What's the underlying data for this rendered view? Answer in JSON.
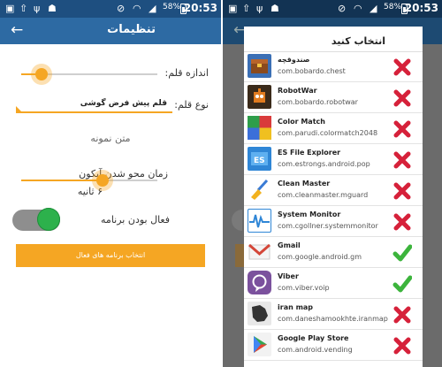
{
  "status_bar": {
    "time": "20:53",
    "battery": "58%"
  },
  "settings": {
    "title": "تنظیمات",
    "pen_size_label": "اندازه قلم:",
    "pen_size_level": 0.15,
    "pen_type_label": "نوع قلم:",
    "pen_type_value": "قلم پیش فرض گوشی",
    "sample_text": "متن نمونه",
    "fade_label": "زمان محو شدن آیکون",
    "fade_value": "۶ ثانیه",
    "fade_level": 0.6,
    "enable_label": "فعال بودن برنامه",
    "enabled": true,
    "select_apps_button": "انتخاب برنامه های فعال"
  },
  "dialog": {
    "title": "انتخاب کنید",
    "apps": [
      {
        "name": "صندوقچه",
        "package": "com.bobardo.chest",
        "selected": false,
        "icon": "chest-icon"
      },
      {
        "name": "RobotWar",
        "package": "com.bobardo.robotwar",
        "selected": false,
        "icon": "robot-icon"
      },
      {
        "name": "Color Match",
        "package": "com.parudi.colormatch2048",
        "selected": false,
        "icon": "color-grid-icon"
      },
      {
        "name": "ES File Explorer",
        "package": "com.estrongs.android.pop",
        "selected": false,
        "icon": "es-explorer-icon"
      },
      {
        "name": "Clean Master",
        "package": "com.cleanmaster.mguard",
        "selected": false,
        "icon": "broom-icon"
      },
      {
        "name": "System Monitor",
        "package": "com.cgollner.systemmonitor",
        "selected": false,
        "icon": "pulse-monitor-icon"
      },
      {
        "name": "Gmail",
        "package": "com.google.android.gm",
        "selected": true,
        "icon": "gmail-icon"
      },
      {
        "name": "Viber",
        "package": "com.viber.voip",
        "selected": true,
        "icon": "viber-icon"
      },
      {
        "name": "iran map",
        "package": "com.daneshamookhte.iranmap",
        "selected": false,
        "icon": "iran-map-icon"
      },
      {
        "name": "Google Play Store",
        "package": "com.android.vending",
        "selected": false,
        "icon": "play-store-icon"
      }
    ]
  },
  "colors": {
    "status_bar": "#1e4f80",
    "app_bar": "#2d6aa3",
    "accent": "#f5a623",
    "toggle_on": "#2db14c",
    "reject": "#d6213a",
    "accept": "#3cb43c"
  }
}
